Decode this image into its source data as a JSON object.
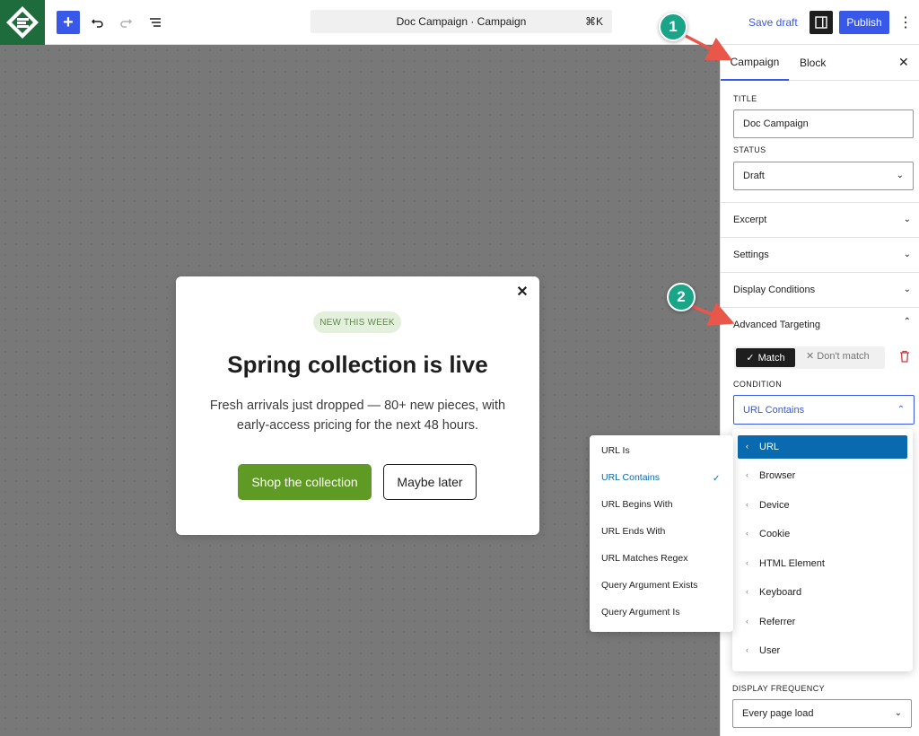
{
  "toolbar": {
    "command_title": "Doc Campaign · Campaign",
    "command_shortcut": "⌘K",
    "save_draft_label": "Save draft",
    "publish_label": "Publish"
  },
  "popup": {
    "badge": "NEW THIS WEEK",
    "title": "Spring collection is live",
    "text": "Fresh arrivals just dropped — 80+ new pieces, with early-access pricing for the next 48 hours.",
    "primary_button": "Shop the collection",
    "secondary_button": "Maybe later",
    "primary_color": "#5f9a25"
  },
  "sidebar": {
    "tabs": [
      {
        "label": "Campaign",
        "active": true
      },
      {
        "label": "Block",
        "active": false
      }
    ],
    "title_label": "TITLE",
    "title_value": "Doc Campaign",
    "status_label": "STATUS",
    "status_value": "Draft",
    "sections": [
      "Excerpt",
      "Settings",
      "Display Conditions",
      "Advanced Targeting"
    ],
    "match_label": "Match",
    "dont_match_label": "Don't match",
    "condition_label": "CONDITION",
    "condition_value": "URL Contains",
    "frequency_label": "DISPLAY FREQUENCY",
    "frequency_value": "Every page load"
  },
  "condition_categories": [
    "URL",
    "Browser",
    "Device",
    "Cookie",
    "HTML Element",
    "Keyboard",
    "Referrer",
    "User"
  ],
  "active_category": "URL",
  "url_conditions": [
    "URL Is",
    "URL Contains",
    "URL Begins With",
    "URL Ends With",
    "URL Matches Regex",
    "Query Argument Exists",
    "Query Argument Is"
  ],
  "selected_condition": "URL Contains",
  "annotations": [
    "1",
    "2"
  ],
  "colors": {
    "accent": "#3858e9",
    "annotation": "#1aa588",
    "arrow": "#e8574a",
    "menu_highlight": "#0a6ab0"
  }
}
